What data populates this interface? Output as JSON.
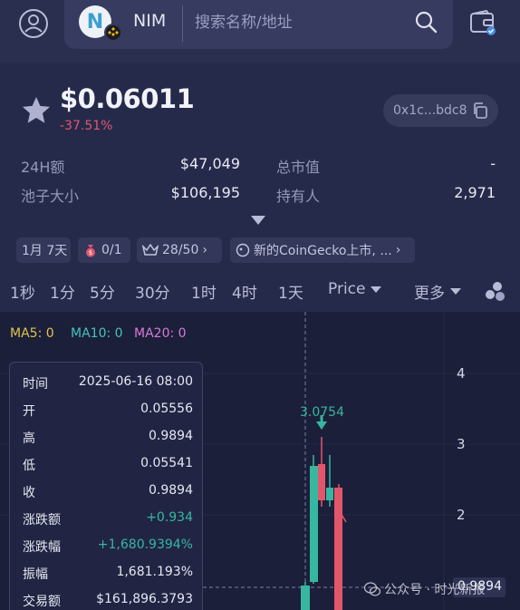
{
  "header": {
    "token_logo_letter": "N",
    "token_name": "NIM",
    "search_placeholder": "搜索名称/地址"
  },
  "price_header": {
    "price": "$0.06011",
    "change": "-37.51%",
    "address": "0x1c...bdc8"
  },
  "stats": [
    {
      "label": "24H额",
      "value": "$47,049"
    },
    {
      "label": "池子大小",
      "value": "$106,195"
    },
    {
      "label": "总市值",
      "value": "-"
    },
    {
      "label": "持有人",
      "value": "2,971"
    }
  ],
  "chips": [
    {
      "label": "1月 7天"
    },
    {
      "label": "0/1"
    },
    {
      "label": "28/50"
    },
    {
      "label": "新的CoinGecko上市, ..."
    }
  ],
  "timeframes": [
    "1秒",
    "1分",
    "5分",
    "30分",
    "1时",
    "4时",
    "1天"
  ],
  "selectors": {
    "price": "Price",
    "more": "更多"
  },
  "chart": {
    "ma": [
      {
        "label": "MA5: 0",
        "color": "#e0c24b"
      },
      {
        "label": "MA10: 0",
        "color": "#44c3b9"
      },
      {
        "label": "MA20: 0",
        "color": "#d67ad6"
      }
    ],
    "y_ticks": [
      "4",
      "3",
      "2"
    ],
    "peak_label": "3.0754",
    "last_price_label": "0.9894",
    "up_color": "#37b7a0",
    "down_color": "#e2566b"
  },
  "tooltip": [
    {
      "label": "时间",
      "value": "2025-06-16 08:00",
      "up": false
    },
    {
      "label": "开",
      "value": "0.05556",
      "up": false
    },
    {
      "label": "高",
      "value": "0.9894",
      "up": false
    },
    {
      "label": "低",
      "value": "0.05541",
      "up": false
    },
    {
      "label": "收",
      "value": "0.9894",
      "up": false
    },
    {
      "label": "涨跌额",
      "value": "+0.934",
      "up": true
    },
    {
      "label": "涨跌幅",
      "value": "+1,680.9394%",
      "up": true
    },
    {
      "label": "振幅",
      "value": "1,681.193%",
      "up": false
    },
    {
      "label": "交易额",
      "value": "$161,896.3793",
      "up": false
    }
  ],
  "watermark": "公众号 · 时光新报"
}
